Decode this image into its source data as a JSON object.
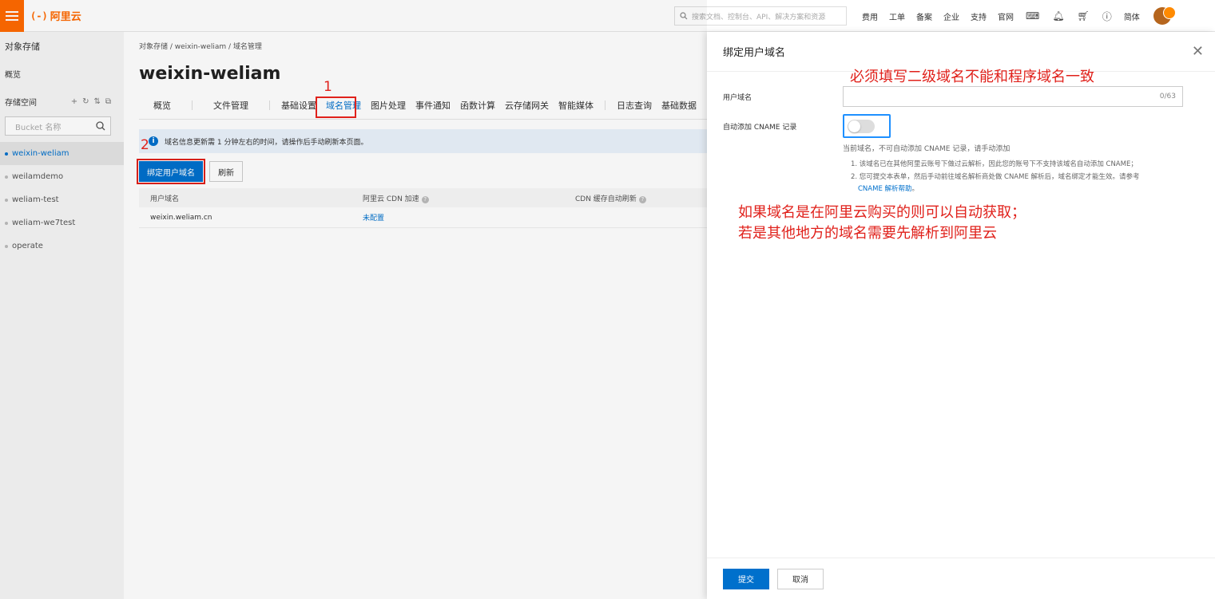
{
  "topbar": {
    "logo_mark": "(-)",
    "logo_text": "阿里云",
    "search_placeholder": "搜索文档、控制台、API、解决方案和资源",
    "nav": [
      "费用",
      "工单",
      "备案",
      "企业",
      "支持",
      "官网"
    ],
    "lang": "简体"
  },
  "sidebar": {
    "title": "对象存储",
    "overview": "概览",
    "buckets_label": "存储空间",
    "bucket_search_placeholder": "Bucket 名称",
    "buckets": [
      "weixin-weliam",
      "weilamdemo",
      "weliam-test",
      "weliam-we7test",
      "operate"
    ]
  },
  "main": {
    "breadcrumb": "对象存储  /  weixin-weliam  /  域名管理",
    "title": "weixin-weliam",
    "tabs": [
      "概览",
      "文件管理",
      "基础设置",
      "域名管理",
      "图片处理",
      "事件通知",
      "函数计算",
      "云存储网关",
      "智能媒体",
      "日志查询",
      "基础数据"
    ],
    "notice": "域名信息更新需 1 分钟左右的时间，请操作后手动刷新本页面。",
    "bind_button": "绑定用户域名",
    "refresh_button": "刷新",
    "table": {
      "headers": [
        "用户域名",
        "阿里云 CDN 加速",
        "CDN 缓存自动刷新"
      ],
      "rows": [
        [
          "weixin.weliam.cn",
          "未配置",
          ""
        ]
      ]
    }
  },
  "annotations": {
    "num1": "1",
    "num2": "2",
    "must_fill": "必须填写二级域名不能和程序域名一致",
    "if_domain_line1": "如果域名是在阿里云购买的则可以自动获取；",
    "if_domain_line2": "若是其他地方的域名需要先解析到阿里云"
  },
  "drawer": {
    "title": "绑定用户域名",
    "domain_label": "用户域名",
    "domain_counter": "0/63",
    "cname_label": "自动添加 CNAME 记录",
    "cname_hint": "当前域名，不可自动添加 CNAME 记录，请手动添加",
    "note1": "1. 该域名已在其他阿里云账号下做过云解析，因此您的账号下不支持该域名自动添加 CNAME；",
    "note2": "2. 您可提交本表单，然后手动前往域名解析商处做 CNAME 解析后，域名绑定才能生效。请参考",
    "note_link": "CNAME 解析帮助",
    "note_end": "。",
    "submit": "提交",
    "cancel": "取消"
  }
}
